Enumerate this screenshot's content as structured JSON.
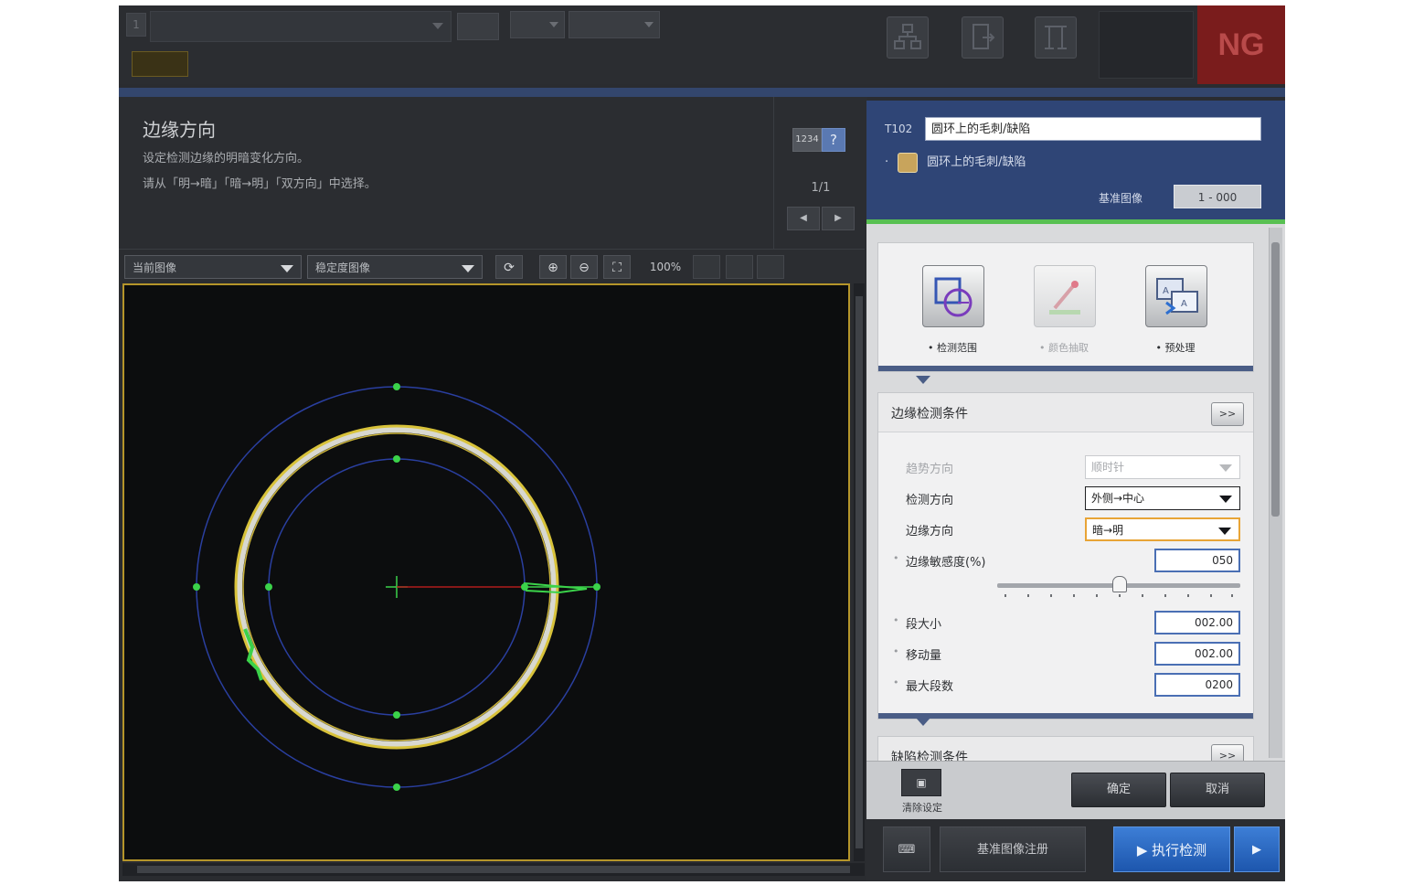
{
  "topbar": {
    "scene_no": "1",
    "scene_name": "",
    "btn_save": "",
    "btn_edit": "",
    "btn_env": "",
    "timing_label1": "",
    "timing_val1": "",
    "timing_label2": "",
    "timing_val2": "",
    "icon1_label": "",
    "icon2_label": "",
    "icon3_label": "",
    "run_mode": "",
    "status": "NG",
    "tab": ""
  },
  "help": {
    "title": "边缘方向",
    "line1": "设定检测边缘的明暗变化方向。",
    "line2": "请从「明→暗」「暗→明」「双方向」中选择。",
    "num_btn": "1234",
    "help_btn": "?",
    "page": "1/1",
    "prev": "◀",
    "next": "▶"
  },
  "image_toolbar": {
    "view_select": "当前图像",
    "filter_select": "稳定度图像",
    "refresh": "⟳",
    "zoom_in": "⊕",
    "zoom_out": "⊖",
    "fit": "⛶",
    "zoom": "100%"
  },
  "tool": {
    "id": "T102",
    "name": "圆环上的毛刺/缺陷",
    "sub": "圆环上的毛刺/缺陷",
    "ref_label": "基准图像",
    "ref_value": "1 - 000"
  },
  "tools": [
    {
      "label": "检测范围",
      "enabled": true
    },
    {
      "label": "颜色抽取",
      "enabled": false
    },
    {
      "label": "预处理",
      "enabled": true
    }
  ],
  "edge_conditions": {
    "title": "边缘检测条件",
    "expand": ">>",
    "trend_dir_label": "趋势方向",
    "trend_dir_value": "顺时针",
    "detect_dir_label": "检测方向",
    "detect_dir_value": "外侧→中心",
    "edge_dir_label": "边缘方向",
    "edge_dir_value": "暗→明",
    "sensitivity_label": "边缘敏感度(%)",
    "sensitivity_value": "050",
    "sensitivity_fraction": 0.5,
    "seg_size_label": "段大小",
    "seg_size_value": "002.00",
    "shift_label": "移动量",
    "shift_value": "002.00",
    "max_seg_label": "最大段数",
    "max_seg_value": "0200"
  },
  "defect_conditions": {
    "title": "缺陷检测条件",
    "expand": ">>"
  },
  "footer": {
    "clear_icon": "▣",
    "clear_label": "清除设定",
    "ok": "确定",
    "cancel": "取消"
  },
  "bottom": {
    "kbd": "⌨",
    "ref_register": "基准图像注册",
    "run": "执行检测",
    "run_icon": "▶",
    "run2": "▶"
  },
  "colors": {
    "accent_blue": "#2f4576",
    "ng_red": "#7a1c1c",
    "highlight_orange": "#e8a436",
    "overlay_yellow": "#d8c23a",
    "overlay_green": "#3bd24a",
    "overlay_blue": "#2a3fa0"
  }
}
